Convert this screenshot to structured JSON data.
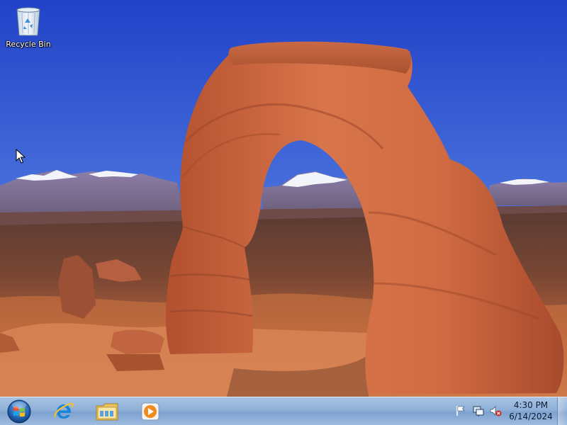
{
  "desktop": {
    "icons": [
      {
        "label": "Recycle Bin",
        "icon": "recycle-bin-icon"
      }
    ]
  },
  "taskbar": {
    "start_icon": "windows-start-orb-icon",
    "pinned": [
      {
        "icon": "internet-explorer-icon"
      },
      {
        "icon": "windows-explorer-icon"
      },
      {
        "icon": "windows-media-player-icon"
      }
    ],
    "tray": {
      "icons": [
        "action-center-flag-icon",
        "network-icon",
        "volume-muted-icon"
      ],
      "clock": {
        "time": "4:30 PM",
        "date": "6/14/2024"
      }
    }
  },
  "colors": {
    "sky_top": "#2446c9",
    "sky_bottom": "#6f9be6",
    "rock": "#c8603a",
    "taskbar": "#9dbbe0"
  }
}
